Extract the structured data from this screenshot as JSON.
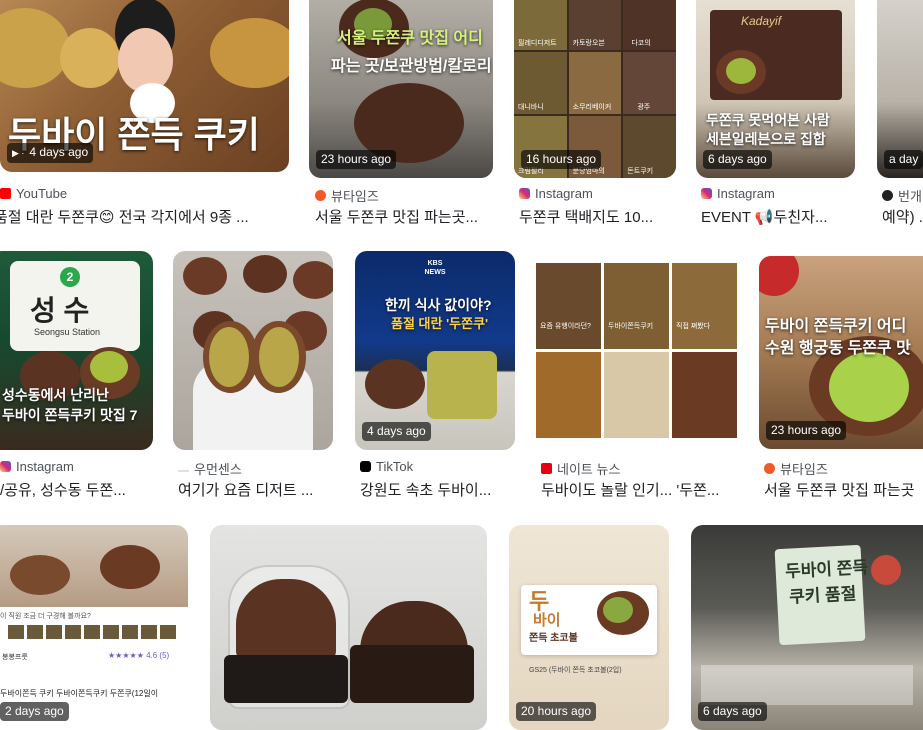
{
  "results": [
    {
      "badge": "4 days ago",
      "play": "▶ ·",
      "source": "YouTube",
      "title": "품절 대란 두쫀쿠😊 전국 각지에서 9종 ...",
      "overlay": "두바이 쫀득 쿠키"
    },
    {
      "badge": "23 hours ago",
      "source": "뷰타임즈",
      "title": "서울 두쫀쿠 맛집 파는곳...",
      "overlay1": "서울 두쫀쿠 맛집 어디",
      "overlay2": "파는 곳/보관방법/칼로리"
    },
    {
      "badge": "16 hours ago",
      "source": "Instagram",
      "title": "두쫀쿠 택배지도 10...",
      "cells": [
        "필레디디저트",
        "카토랑오븐",
        "다코의",
        "대니바니",
        "소무리베이커",
        "광주",
        "크림펄리",
        "분당엄마의",
        "돈트쿠키"
      ]
    },
    {
      "badge": "6 days ago",
      "source": "Instagram",
      "title": "EVENT 📢두친자...",
      "overlay1": "두쫀쿠 못먹어본 사람",
      "overlay2": "세븐일레븐으로 집합",
      "box": "Kadayif"
    },
    {
      "badge": "a day",
      "source": "번개",
      "title": "예약) ..."
    },
    {
      "badge": "",
      "source": "Instagram",
      "title": "/공유, 성수동 두쫀...",
      "sign_big": "성 수",
      "sign_small": "Seongsu Station",
      "sign_num": "2",
      "overlay1": "성수동에서 난리난",
      "overlay2": "두바이 쫀득쿠키 맛집 7"
    },
    {
      "badge": "",
      "source": "우먼센스",
      "title": "여기가 요즘 디저트 ..."
    },
    {
      "badge": "4 days ago",
      "source": "TikTok",
      "title": "강원도 속초 두바이...",
      "logo": "KBS NEWS",
      "overlay1": "한끼 식사 값이야?",
      "overlay2": "품절 대란 '두쫀쿠'"
    },
    {
      "badge": "",
      "source": "네이트 뉴스",
      "title": "두바이도 놀랄 인기... '두쫀...",
      "cells": [
        "요즘 유행이라던?",
        "두바이쫀득쿠키",
        "직접 쪄봤다"
      ]
    },
    {
      "badge": "23 hours ago",
      "source": "뷰타임즈",
      "title": "서울 두쫀쿠 맛집 파는곳",
      "overlay1": "두바이 쫀득쿠키 어디",
      "overlay2": "수원 행궁동 두쫀쿠 맛"
    },
    {
      "badge": "2 days ago",
      "source": "",
      "title": "",
      "strip_text": "이 직원 조금 더 구경해 볼까요?",
      "rating": "★★★★★ 4.6 (5)",
      "shop": "봉봉프룻",
      "product": "두바이쫀득 쿠키 두바이쫀득쿠키 두쫀쿠(12일이"
    },
    {
      "badge": "",
      "source": "",
      "title": ""
    },
    {
      "badge": "20 hours ago",
      "source": "",
      "title": "",
      "pack_top": "두",
      "pack_mid": "바이",
      "pack_bottom": "쫀득 초코볼",
      "pack_small": "GS25 (두바이 쫀득 초코볼(2입)"
    },
    {
      "badge": "6 days ago",
      "source": "",
      "title": "",
      "sign_line1": "두바이 쫀득",
      "sign_line2": "쿠키 품절"
    }
  ],
  "colors": {
    "youtube": "#ff0000",
    "instagram": "#d6249f",
    "buta": "#f05a28",
    "tiktok": "#000000",
    "nate": "#e60012",
    "bungae": "#222222",
    "chocolate": "#5a3322",
    "pistachio": "#9fb843"
  }
}
